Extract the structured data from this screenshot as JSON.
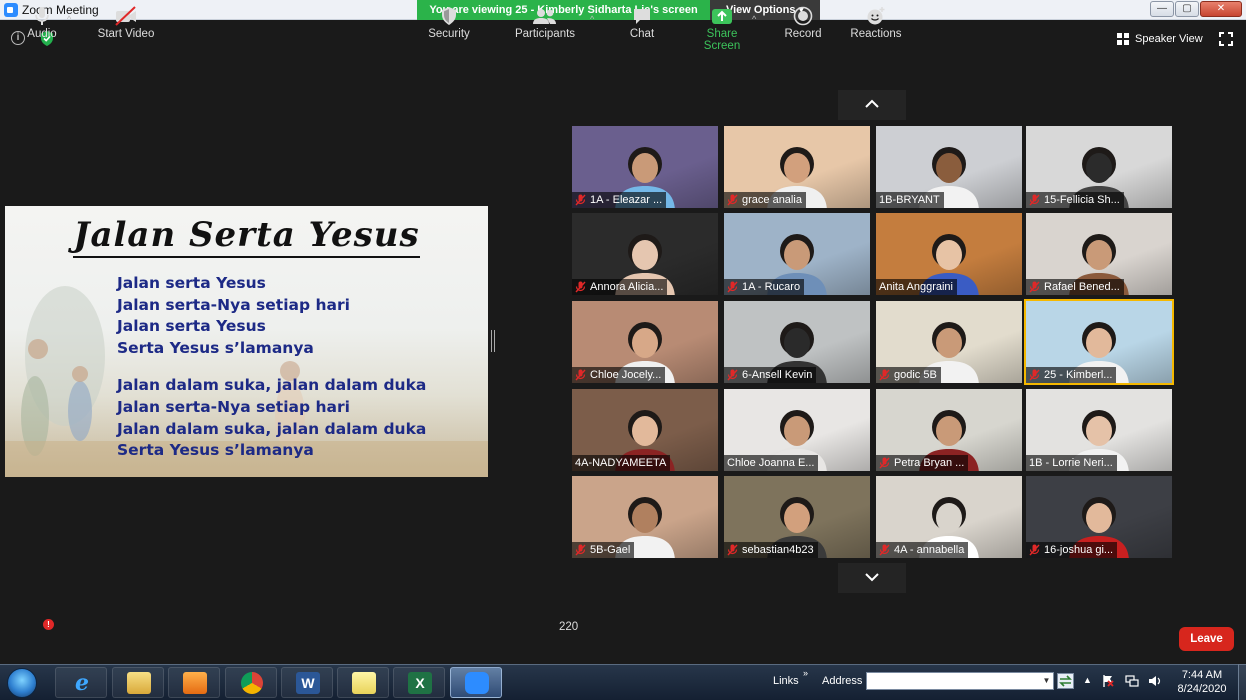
{
  "window": {
    "title": "Zoom Meeting",
    "viewing_banner": "You are viewing 25 - Kimberly Sidharta Lie's screen",
    "view_options": "View Options ▾",
    "minimize_glyph": "—",
    "maximize_glyph": "▢",
    "close_glyph": "✕"
  },
  "top_bar": {
    "info_glyph": "i",
    "speaker_view_label": "Speaker View"
  },
  "shared_screen": {
    "title": "Jalan Serta Yesus",
    "verse1": [
      "Jalan serta Yesus",
      "Jalan serta-Nya setiap hari",
      "Jalan serta Yesus",
      "Serta Yesus s’lamanya"
    ],
    "verse2": [
      "Jalan dalam suka, jalan dalam duka",
      "Jalan serta-Nya setiap hari",
      "Jalan dalam suka, jalan dalam duka",
      "Serta Yesus s’lamanya"
    ]
  },
  "gallery": {
    "tiles": [
      {
        "name": "1A - Eleazar ...",
        "muted": true,
        "bg": "#6a5f8e",
        "skin": "#c99a78",
        "shirt": "#74b8e8",
        "active": false
      },
      {
        "name": "grace analia",
        "muted": true,
        "bg": "#e7c7a8",
        "skin": "#d2a07d",
        "shirt": "#f0f0f0",
        "active": false
      },
      {
        "name": "1B-BRYANT",
        "muted": false,
        "bg": "#cdcfd3",
        "skin": "#8a5d3d",
        "shirt": "#f2f2f2",
        "active": false
      },
      {
        "name": "15-Fellicia Sh...",
        "muted": true,
        "bg": "#d8d8d8",
        "skin": "#2b2b2b",
        "shirt": "#444444",
        "active": false
      },
      {
        "name": "Annora Alicia...",
        "muted": true,
        "bg": "#2b2b2b",
        "skin": "#e5c6b0",
        "shirt": "#e5c6b0",
        "active": false
      },
      {
        "name": "1A - Rucaro",
        "muted": true,
        "bg": "#9eb3c8",
        "skin": "#c99a78",
        "shirt": "#6e8fb8",
        "active": false
      },
      {
        "name": "Anita Anggraini",
        "muted": false,
        "bg": "#c47d3e",
        "skin": "#e7c3a5",
        "shirt": "#3a5cc4",
        "active": false
      },
      {
        "name": "Rafael Bened...",
        "muted": true,
        "bg": "#d9d4cf",
        "skin": "#c99a78",
        "shirt": "#8b5a3c",
        "active": false
      },
      {
        "name": "Chloe Jocely...",
        "muted": true,
        "bg": "#b88b74",
        "skin": "#d7a888",
        "shirt": "#f0f0f0",
        "active": false
      },
      {
        "name": "6-Ansell Kevin",
        "muted": true,
        "bg": "#bfc2c3",
        "skin": "#2a2a2a",
        "shirt": "#333333",
        "active": false
      },
      {
        "name": "godic 5B",
        "muted": true,
        "bg": "#e2dccd",
        "skin": "#c99a78",
        "shirt": "#f2f2f2",
        "active": false
      },
      {
        "name": "25 - Kimberl...",
        "muted": true,
        "bg": "#b9d6e7",
        "skin": "#e2b99b",
        "shirt": "#f2f2f2",
        "active": true
      },
      {
        "name": "4A-NADYAMEETA",
        "muted": false,
        "bg": "#7c5d4a",
        "skin": "#e2b99b",
        "shirt": "#8b2323",
        "active": false
      },
      {
        "name": "Chloe Joanna E...",
        "muted": false,
        "bg": "#e8e6e4",
        "skin": "#c99a78",
        "shirt": "#e8e6e4",
        "active": false
      },
      {
        "name": "Petra Bryan ...",
        "muted": true,
        "bg": "#d7d6cf",
        "skin": "#c99a78",
        "shirt": "#8b2323",
        "active": false
      },
      {
        "name": "1B - Lorrie Neri...",
        "muted": false,
        "bg": "#e3e2e0",
        "skin": "#e5c2a8",
        "shirt": "#f2f2f2",
        "active": false
      },
      {
        "name": "5B-Gael",
        "muted": true,
        "bg": "#caa48a",
        "skin": "#b0805f",
        "shirt": "#f2f2f2",
        "active": false
      },
      {
        "name": "sebastian4b23",
        "muted": true,
        "bg": "#7e735c",
        "skin": "#d2a07d",
        "shirt": "#3a3a3a",
        "active": false
      },
      {
        "name": "4A - annabella",
        "muted": true,
        "bg": "#d9d4cc",
        "skin": "#d9d4cc",
        "shirt": "#ffffff",
        "active": false
      },
      {
        "name": "16-joshua gi...",
        "muted": true,
        "bg": "#3d3f45",
        "skin": "#e2b99b",
        "shirt": "#c82020",
        "active": false
      }
    ]
  },
  "toolbar": {
    "audio": "Audio",
    "audio_badge": "!",
    "start_video": "Start Video",
    "security": "Security",
    "participants": "Participants",
    "participants_count": "220",
    "chat": "Chat",
    "share_screen": "Share Screen",
    "record": "Record",
    "reactions": "Reactions",
    "leave": "Leave",
    "caret": "^"
  },
  "taskbar": {
    "links": "Links",
    "links_chevron": "»",
    "address": "Address",
    "address_value": "",
    "address_dropdown": "▼",
    "tray_arrow": "▲",
    "time": "7:44 AM",
    "date": "8/24/2020"
  },
  "colors": {
    "share_green": "#3cc35b",
    "leave_red": "#d7261d",
    "lyrics_blue": "#1d2a86",
    "banner_green": "#2bb34a"
  },
  "icons": [
    "info-icon",
    "shield-check-icon",
    "grid-icon",
    "fullscreen-icon",
    "chevron-up-icon",
    "chevron-down-icon",
    "mic-muted-icon",
    "microphone-icon",
    "video-off-icon",
    "shield-icon",
    "participants-icon",
    "chat-icon",
    "share-arrow-icon",
    "record-icon",
    "reaction-smile-icon"
  ]
}
